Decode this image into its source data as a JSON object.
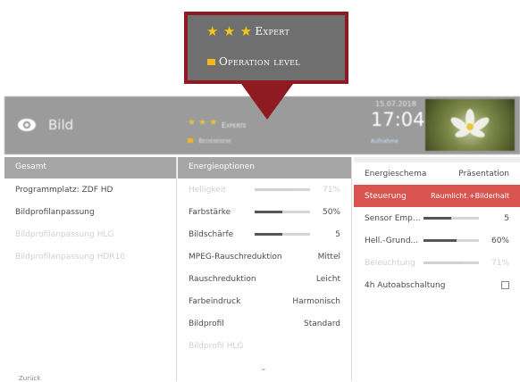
{
  "callout": {
    "stars": "★ ★ ★",
    "expert_label": "Expert",
    "operation_label": "Operation level"
  },
  "topbar": {
    "title": "Bild",
    "stars": "★ ★ ★",
    "expert_label": "Experte",
    "operation_label": "Bedienebene",
    "date": "15.07.2018",
    "time": "17:04",
    "recording": "Aufnahme"
  },
  "col1": {
    "header": "Gesamt",
    "items": [
      {
        "label": "Programmplatz: ZDF HD",
        "faded": false
      },
      {
        "label": "Bildprofilanpassung",
        "faded": false
      },
      {
        "label": "Bildprofilanpassung HLG",
        "faded": true
      },
      {
        "label": "Bildprofilanpassung HDR10",
        "faded": true
      }
    ],
    "bottom_note": "Zurück"
  },
  "col2": {
    "header": "Energieoptionen",
    "items": [
      {
        "label": "Helligkeit",
        "value": "71%",
        "slider": 0.71,
        "faded": true
      },
      {
        "label": "Farbstärke",
        "value": "50%",
        "slider": 0.5,
        "faded": false
      },
      {
        "label": "Bildschärfe",
        "value": "5",
        "slider": 0.5,
        "faded": false
      },
      {
        "label": "MPEG-Rauschreduktion",
        "value": "Mittel",
        "faded": false
      },
      {
        "label": "Rauschreduktion",
        "value": "Leicht",
        "faded": false
      },
      {
        "label": "Farbeindruck",
        "value": "Harmonisch",
        "faded": false
      },
      {
        "label": "Bildprofil",
        "value": "Standard",
        "faded": false
      },
      {
        "label": "Bildprofil HLG",
        "value": "",
        "faded": true
      }
    ]
  },
  "col3": {
    "header_label": "Energieschema",
    "header_value": "Präsentation",
    "items": [
      {
        "label": "Steuerung",
        "value": "Raumlicht.+Bilderhalt",
        "selected": true
      },
      {
        "label": "Sensor Emp...",
        "value": "5",
        "slider": 0.5
      },
      {
        "label": "Hell.-Grund...",
        "value": "60%",
        "slider": 0.6
      },
      {
        "label": "Beleuchtung",
        "value": "71%",
        "slider": 0.71,
        "faded": true
      },
      {
        "label": "4h Autoabschaltung",
        "checkbox": true
      }
    ]
  },
  "colors": {
    "accent_red": "#d9534f",
    "callout_border": "#8e1b22",
    "star": "#f5c518"
  }
}
